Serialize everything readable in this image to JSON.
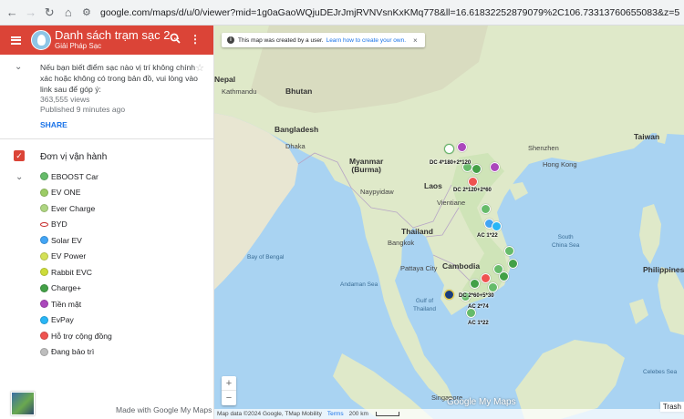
{
  "browser": {
    "back_icon": "back-arrow-icon",
    "forward_icon": "forward-arrow-icon",
    "reload_icon": "reload-icon",
    "home_icon": "home-icon",
    "url": "google.com/maps/d/u/0/viewer?mid=1g0aGaoWQjuDEJrJmjRVNVsnKxKMq778&ll=16.61832252879079%2C106.73313760655083&z=5"
  },
  "panel": {
    "title": "Danh sách trạm sạc 2...",
    "subtitle": "Giải Pháp Sạc",
    "description": "Nếu bạn biết điểm sạc nào vị trí không chính xác hoặc không có trong bản đồ, vui lòng vào link sau để góp ý:",
    "views": "363,555 views",
    "published": "Published 9 minutes ago",
    "share_label": "SHARE",
    "layer_name": "Đơn vị vận hành",
    "legend": [
      {
        "label": "EBOOST Car",
        "color": "#66bb6a"
      },
      {
        "label": "EV ONE",
        "color": "#9ccc65"
      },
      {
        "label": "Ever Charge",
        "color": "#aed581"
      },
      {
        "label": "BYD",
        "color": "#c62828"
      },
      {
        "label": "Solar EV",
        "color": "#42a5f5"
      },
      {
        "label": "EV Power",
        "color": "#d4e157"
      },
      {
        "label": "Rabbit EVC",
        "color": "#cddc39"
      },
      {
        "label": "Charge+",
        "color": "#43a047"
      },
      {
        "label": "Tiền mặt",
        "color": "#ab47bc"
      },
      {
        "label": "EvPay",
        "color": "#29b6f6"
      },
      {
        "label": "Hỗ trợ cộng đồng",
        "color": "#ef5350"
      },
      {
        "label": "Đang bảo trì",
        "color": "#bdbdbd"
      }
    ],
    "made_with": "Made with Google My Maps"
  },
  "map": {
    "notice_text": "This map was created by a user.",
    "notice_link": "Learn how to create your own.",
    "zoom_in": "+",
    "zoom_out": "−",
    "attribution": "Map data ©2024 Google, TMap Mobility",
    "terms": "Terms",
    "scale": "200 km",
    "logo": "Google My Maps",
    "trash": "Trash",
    "labels": {
      "nepal": "Nepal",
      "kathmandu": "Kathmandu",
      "bhutan": "Bhutan",
      "bangladesh": "Bangladesh",
      "dhaka": "Dhaka",
      "myanmar": "Myanmar\n(Burma)",
      "naypyidaw": "Naypyidaw",
      "laos": "Laos",
      "vientiane": "Vientiane",
      "thailand": "Thailand",
      "bangkok": "Bangkok",
      "cambodia": "Cambodia",
      "taiwan": "Taiwan",
      "hongkong": "Hong Kong",
      "shenzhen": "Shenzhen",
      "philippines": "Philippines",
      "bay_of_bengal": "Bay of Bengal",
      "andaman_sea": "Andaman Sea",
      "gulf_of_thailand": "Gulf of\nThailand",
      "south_china_sea": "South\nChina Sea",
      "celebes_sea": "Celebes Sea",
      "singapore": "Singapore",
      "pattaya": "Pattaya City"
    },
    "pin_labels": [
      "DC 4*180+2*120",
      "DC 2*120+2*60",
      "AC 1*22",
      "DC 2*60+5*30",
      "AC 2*74",
      "AC 1*22"
    ]
  }
}
